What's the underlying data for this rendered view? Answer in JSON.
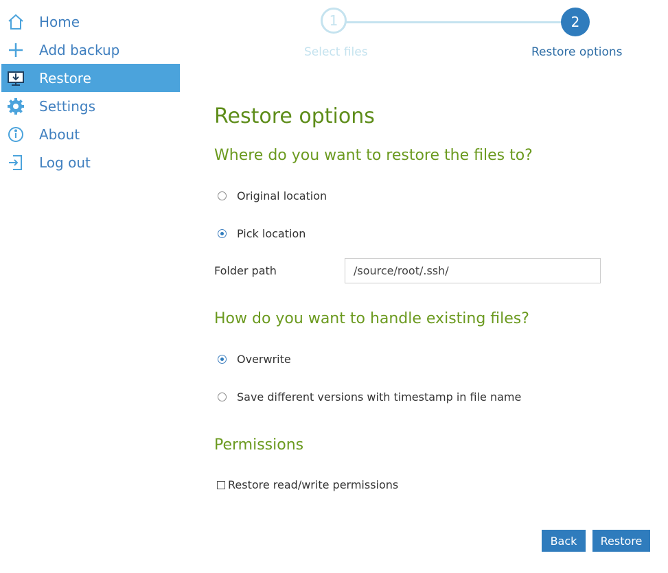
{
  "sidebar": {
    "items": [
      {
        "label": "Home",
        "icon": "home-icon"
      },
      {
        "label": "Add backup",
        "icon": "plus-icon"
      },
      {
        "label": "Restore",
        "icon": "restore-icon",
        "active": true
      },
      {
        "label": "Settings",
        "icon": "gear-icon"
      },
      {
        "label": "About",
        "icon": "info-icon"
      },
      {
        "label": "Log out",
        "icon": "logout-icon"
      }
    ]
  },
  "stepper": {
    "steps": [
      {
        "number": "1",
        "label": "Select files"
      },
      {
        "number": "2",
        "label": "Restore options"
      }
    ],
    "current_step": 2
  },
  "main": {
    "title": "Restore options",
    "destination": {
      "heading": "Where do you want to restore the files to?",
      "options": [
        "Original location",
        "Pick location"
      ],
      "selected": "Pick location",
      "folder_label": "Folder path",
      "folder_value": "/source/root/.ssh/"
    },
    "existing": {
      "heading": "How do you want to handle existing files?",
      "options": [
        "Overwrite",
        "Save different versions with timestamp in file name"
      ],
      "selected": "Overwrite"
    },
    "permissions": {
      "heading": "Permissions",
      "checkbox_label": "Restore read/write permissions",
      "checked": false
    }
  },
  "buttons": {
    "back": "Back",
    "restore": "Restore"
  },
  "colors": {
    "accent": "#2f7cbd",
    "sidebar_active": "#4ba3dc",
    "heading_green": "#5e8d1a"
  }
}
